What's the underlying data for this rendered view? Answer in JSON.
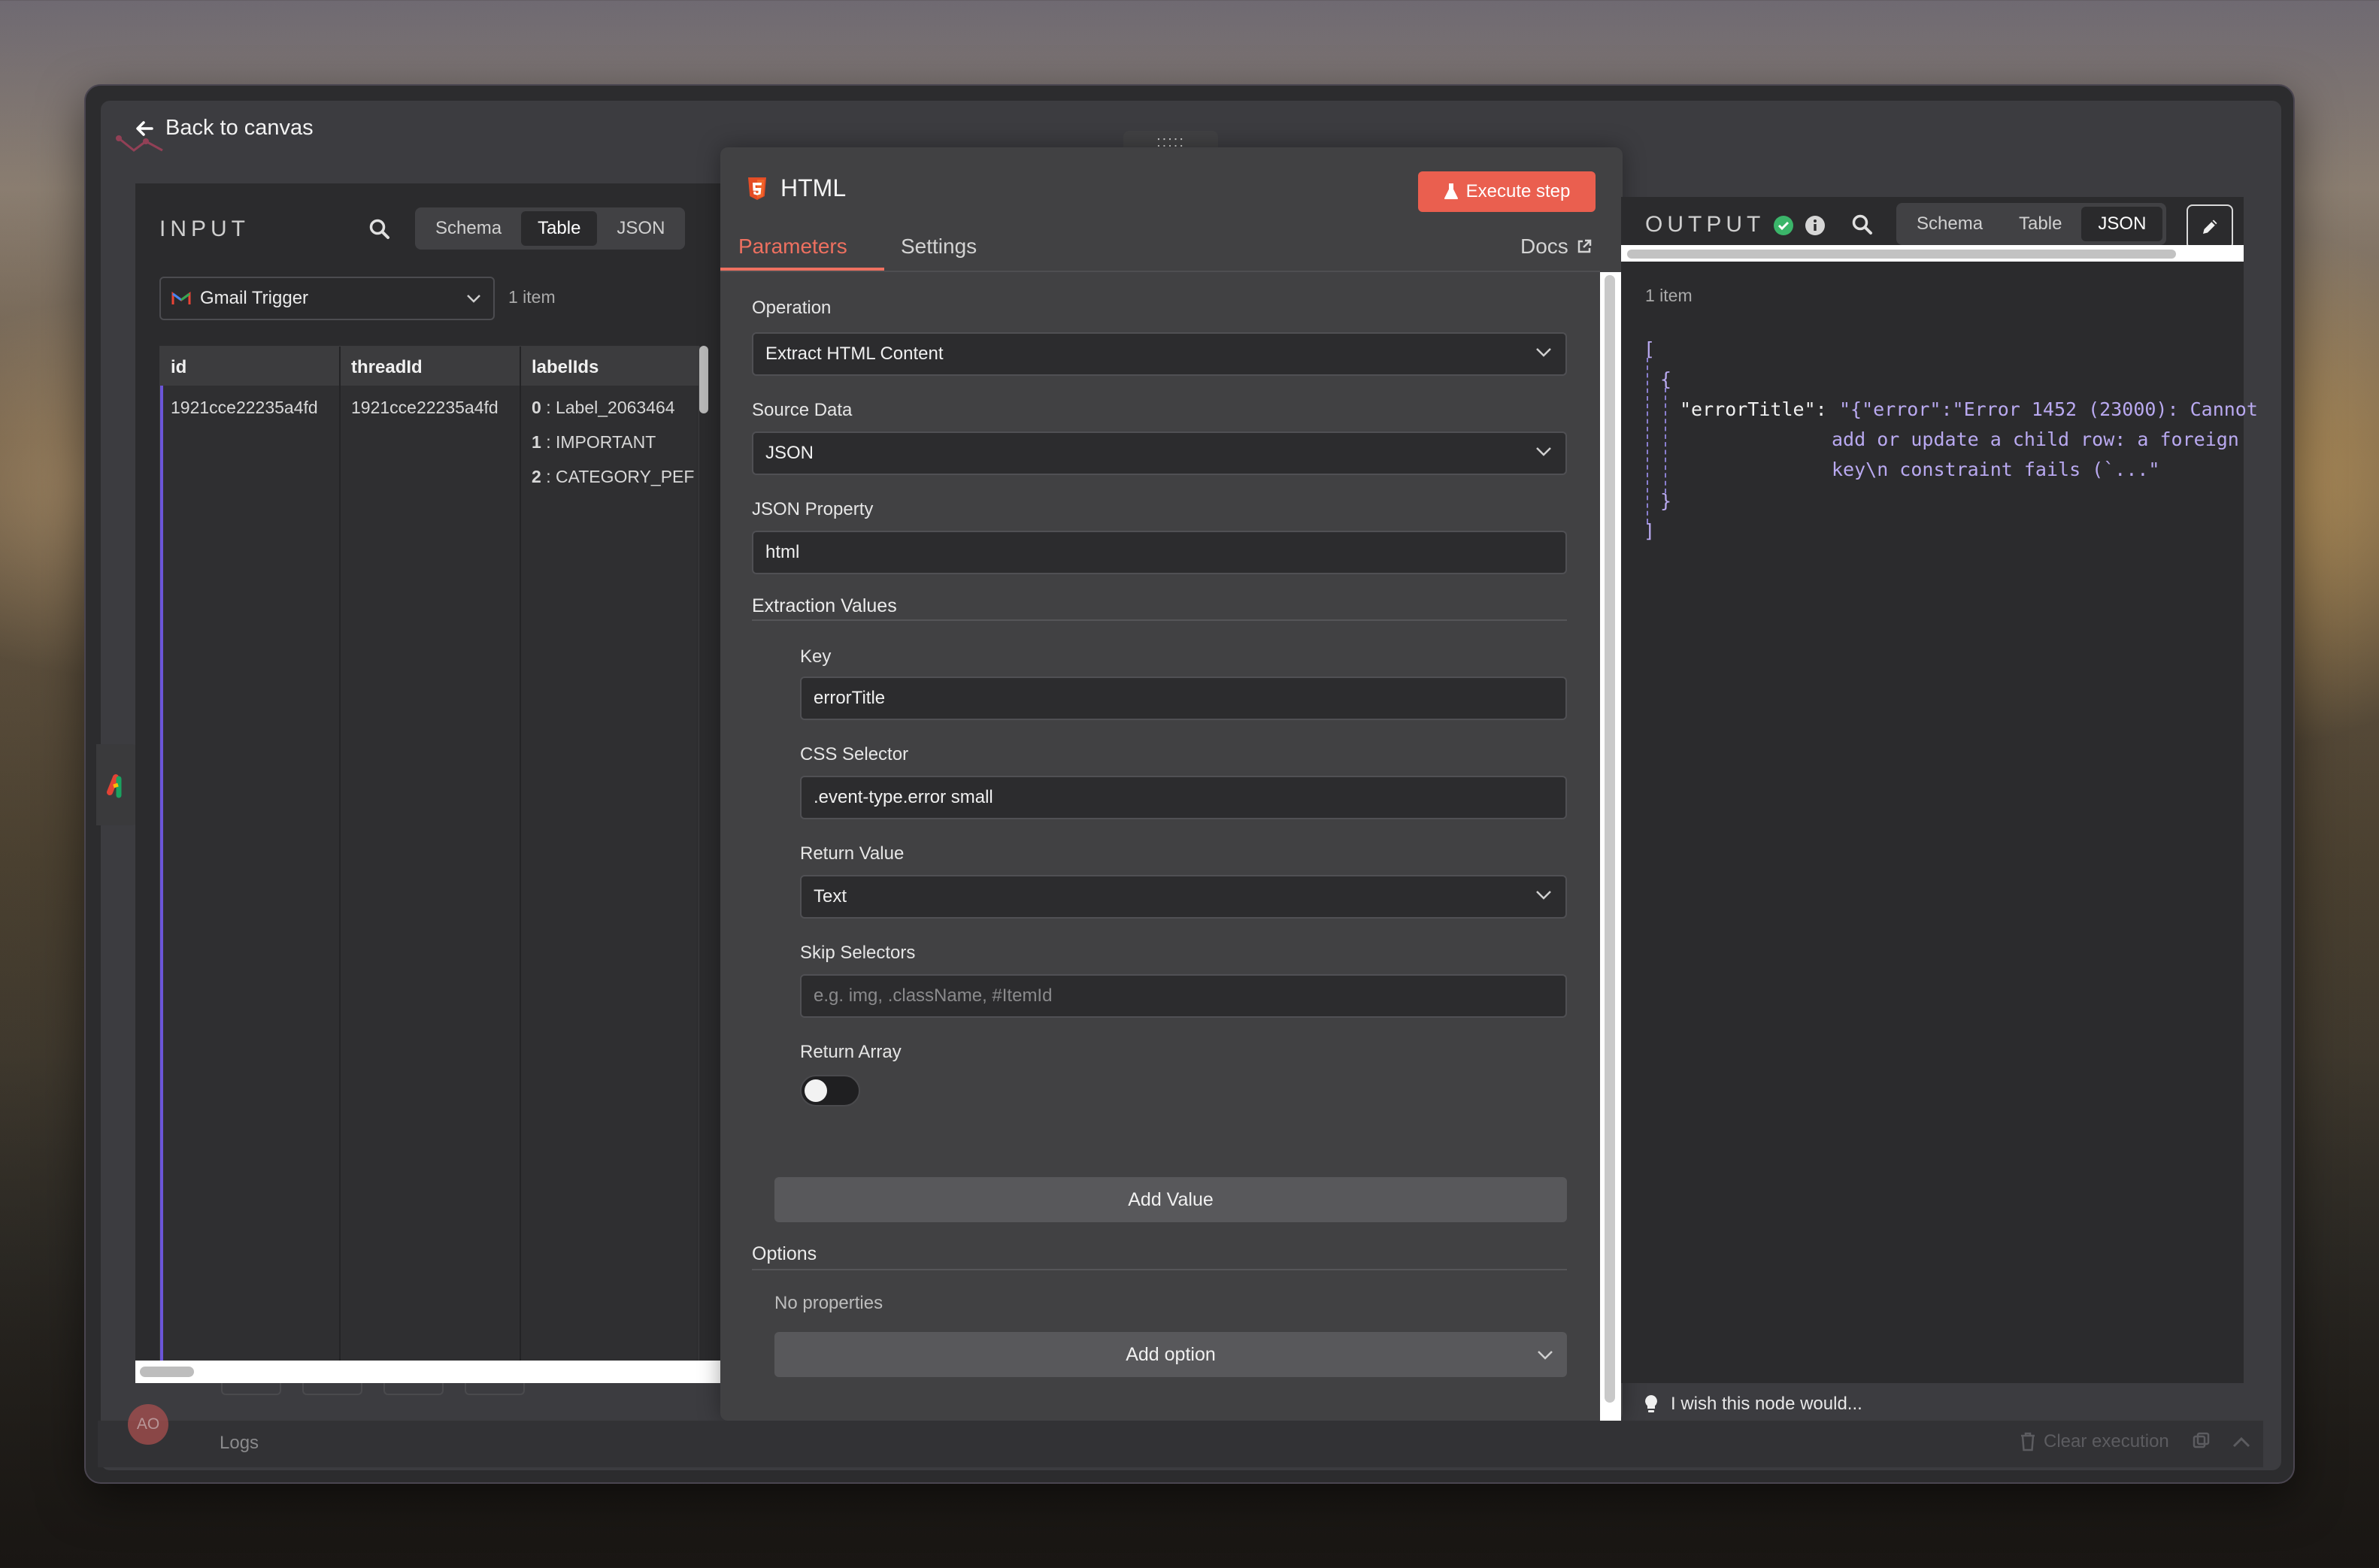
{
  "nav": {
    "back_label": "Back to canvas"
  },
  "input": {
    "title": "INPUT",
    "view_tabs": [
      "Schema",
      "Table",
      "JSON"
    ],
    "active_tab": "Table",
    "node_select": "Gmail Trigger",
    "item_count": "1 item",
    "columns": [
      "id",
      "threadId",
      "labelIds"
    ],
    "row": {
      "id": "1921cce22235a4fd",
      "threadId": "1921cce22235a4fd",
      "labelIds": [
        {
          "index": "0",
          "value": ": Label_2063464"
        },
        {
          "index": "1",
          "value": ": IMPORTANT"
        },
        {
          "index": "2",
          "value": ": CATEGORY_PEF"
        }
      ]
    }
  },
  "node": {
    "drag_handle": ":::::",
    "title": "HTML",
    "execute_label": "Execute step",
    "tabs": [
      "Parameters",
      "Settings"
    ],
    "active_tab": "Parameters",
    "docs_label": "Docs",
    "operation": {
      "label": "Operation",
      "value": "Extract HTML Content"
    },
    "source_data": {
      "label": "Source Data",
      "value": "JSON"
    },
    "json_property": {
      "label": "JSON Property",
      "value": "html"
    },
    "extraction_values": {
      "title": "Extraction Values",
      "key": {
        "label": "Key",
        "value": "errorTitle"
      },
      "css_selector": {
        "label": "CSS Selector",
        "value": ".event-type.error small"
      },
      "return_value": {
        "label": "Return Value",
        "value": "Text"
      },
      "skip_selectors": {
        "label": "Skip Selectors",
        "placeholder": "e.g. img, .className, #ItemId"
      },
      "return_array": {
        "label": "Return Array",
        "enabled": false
      },
      "add_value_label": "Add Value"
    },
    "options": {
      "title": "Options",
      "empty_text": "No properties",
      "add_option_label": "Add option"
    }
  },
  "output": {
    "title": "OUTPUT",
    "view_tabs": [
      "Schema",
      "Table",
      "JSON"
    ],
    "active_tab": "JSON",
    "item_count": "1 item",
    "json_lines": {
      "open_bracket": "[",
      "open_brace": "{",
      "key": "\"errorTitle\":",
      "value_line1": "\"{\"error\":\"Error 1452 (23000): Cannot",
      "value_line2": "add or update a child row: a foreign",
      "value_line3": "key\\n constraint fails (`...\"",
      "close_brace": "}",
      "close_bracket": "]"
    },
    "feedback": "I wish this node would..."
  },
  "footer": {
    "logs_label": "Logs",
    "clear_label": "Clear execution",
    "avatar_initials": "AO"
  },
  "colors": {
    "accent": "#ea5f4f",
    "tab_active": "#ee7060",
    "json_value": "#b9a9f0",
    "success": "#3bb56a",
    "table_accent": "#6b55d9"
  }
}
